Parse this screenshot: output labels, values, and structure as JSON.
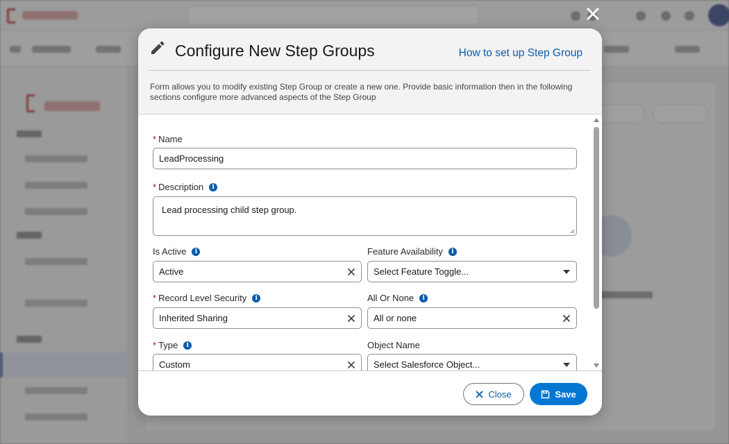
{
  "modal": {
    "title": "Configure New Step Groups",
    "help_link": "How to set up Step Group",
    "description": "Form allows you to modify existing Step Group or create a new one. Provide basic information then in the following sections configure more advanced aspects of the Step Group",
    "icon": "pencil-icon"
  },
  "form": {
    "required_marker": "*",
    "info_glyph": "i",
    "name": {
      "label": "Name",
      "value": "LeadProcessing"
    },
    "description": {
      "label": "Description",
      "value": "Lead processing child step group."
    },
    "is_active": {
      "label": "Is Active",
      "value": "Active"
    },
    "feature_availability": {
      "label": "Feature Availability",
      "placeholder": "Select Feature Toggle..."
    },
    "record_level_security": {
      "label": "Record Level Security",
      "value": "Inherited Sharing"
    },
    "all_or_none": {
      "label": "All Or None",
      "value": "All or none"
    },
    "type": {
      "label": "Type",
      "value": "Custom"
    },
    "object_name": {
      "label": "Object Name",
      "placeholder": "Select Salesforce Object..."
    }
  },
  "footer": {
    "close_label": "Close",
    "save_label": "Save"
  },
  "colors": {
    "brand_blue": "#0176d3",
    "link_blue": "#0b5cab",
    "required_red": "#ba0517"
  }
}
